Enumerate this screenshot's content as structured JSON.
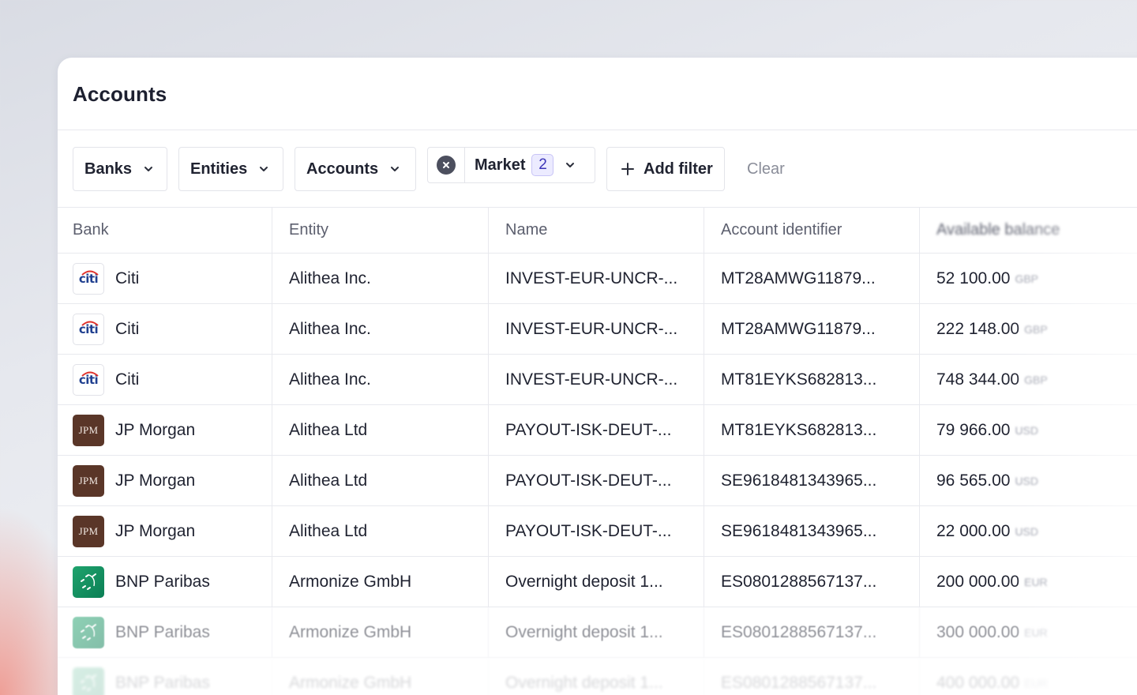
{
  "page": {
    "title": "Accounts"
  },
  "filters": {
    "banks": "Banks",
    "entities": "Entities",
    "accounts": "Accounts",
    "market": {
      "label": "Market",
      "count": "2"
    },
    "add_filter": "Add filter",
    "clear": "Clear"
  },
  "table": {
    "columns": [
      "Bank",
      "Entity",
      "Name",
      "Account identifier",
      "Available balance"
    ],
    "rows": [
      {
        "bank": "Citi",
        "logo": "citi-logo",
        "entity": "Alithea Inc.",
        "name": "INVEST-EUR-UNCR-...",
        "identifier": "MT28AMWG11879...",
        "amount": "52 100.00",
        "currency": "GBP"
      },
      {
        "bank": "Citi",
        "logo": "citi-logo",
        "entity": "Alithea Inc.",
        "name": "INVEST-EUR-UNCR-...",
        "identifier": "MT28AMWG11879...",
        "amount": "222 148.00",
        "currency": "GBP"
      },
      {
        "bank": "Citi",
        "logo": "citi-logo",
        "entity": "Alithea Inc.",
        "name": "INVEST-EUR-UNCR-...",
        "identifier": "MT81EYKS682813...",
        "amount": "748 344.00",
        "currency": "GBP"
      },
      {
        "bank": "JP Morgan",
        "logo": "jpm-logo",
        "logo_text": "JPM",
        "entity": "Alithea Ltd",
        "name": "PAYOUT-ISK-DEUT-...",
        "identifier": "MT81EYKS682813...",
        "amount": "79 966.00",
        "currency": "USD"
      },
      {
        "bank": "JP Morgan",
        "logo": "jpm-logo",
        "logo_text": "JPM",
        "entity": "Alithea Ltd",
        "name": "PAYOUT-ISK-DEUT-...",
        "identifier": "SE9618481343965...",
        "amount": "96 565.00",
        "currency": "USD"
      },
      {
        "bank": "JP Morgan",
        "logo": "jpm-logo",
        "logo_text": "JPM",
        "entity": "Alithea Ltd",
        "name": "PAYOUT-ISK-DEUT-...",
        "identifier": "SE9618481343965...",
        "amount": "22 000.00",
        "currency": "USD"
      },
      {
        "bank": "BNP Paribas",
        "logo": "bnp-logo",
        "entity": "Armonize GmbH",
        "name": "Overnight deposit 1...",
        "identifier": "ES0801288567137...",
        "amount": "200 000.00",
        "currency": "EUR"
      },
      {
        "bank": "BNP Paribas",
        "logo": "bnp-logo",
        "entity": "Armonize GmbH",
        "name": "Overnight deposit 1...",
        "identifier": "ES0801288567137...",
        "amount": "300 000.00",
        "currency": "EUR"
      },
      {
        "bank": "BNP Paribas",
        "logo": "bnp-logo",
        "entity": "Armonize GmbH",
        "name": "Overnight deposit 1...",
        "identifier": "ES0801288567137...",
        "amount": "400 000.00",
        "currency": "EUR"
      }
    ]
  }
}
